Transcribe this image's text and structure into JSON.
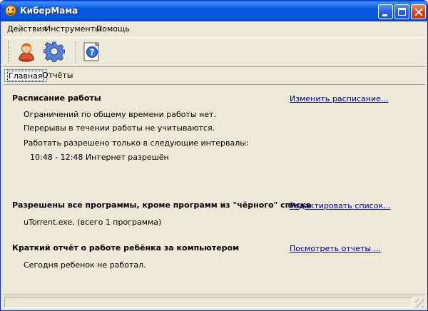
{
  "window": {
    "title": "КиберМама"
  },
  "menu": {
    "items": [
      {
        "label": "Действия"
      },
      {
        "label": "Инструменты"
      },
      {
        "label": "Помощь"
      }
    ]
  },
  "toolbar": {
    "buttons": [
      {
        "icon": "user-icon"
      },
      {
        "icon": "gear-icon"
      },
      {
        "icon": "help-icon"
      }
    ]
  },
  "tabs": [
    {
      "label": "Главная",
      "active": true
    },
    {
      "label": "Отчёты",
      "active": false
    }
  ],
  "schedule": {
    "title": "Расписание работы",
    "link": "Изменить расписание...",
    "lines": [
      "Ограничений по общему времени работы нет.",
      "Перерывы в течении работы не учитываются.",
      "Работать разрешено только в следующие интервалы:"
    ],
    "interval": "10:48 - 12:48 Интернет разрешён"
  },
  "programs": {
    "title": "Разрешены все программы, кроме программ из \"чёрного\" списка",
    "link": "Редактировать список...",
    "line": "uTorrent.exe. (всего 1 программа)"
  },
  "report": {
    "title": "Краткий отчёт о работе ребёнка за компьютером",
    "link": "Посмотреть отчеты ...",
    "line": "Сегодня ребенок не работал."
  }
}
